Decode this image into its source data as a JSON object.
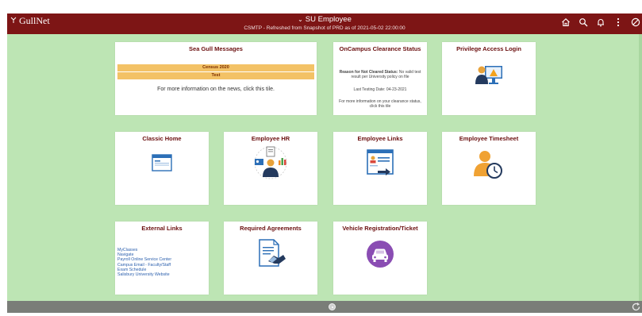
{
  "header": {
    "logo": "GullNet",
    "title": "SU Employee",
    "subtitle": "CSMTP - Refreshed from Snapshot of PRD as of 2021-05-02 22:00:00",
    "icons": [
      "home-icon",
      "search-icon",
      "notification-bell-icon",
      "actions-menu-icon",
      "navbar-icon"
    ]
  },
  "tiles": {
    "sea_gull_messages": {
      "title": "Sea Gull Messages",
      "messages": [
        "Census 2020",
        "Test"
      ],
      "info": "For more information on the news, click this tile."
    },
    "oncampus": {
      "title": "OnCampus Clearance Status",
      "reason_label": "Reason for Not Cleared Status:",
      "reason_value": "No valid test result per University policy on file",
      "last_testing": "Last Testing Date: 04-23-2021",
      "more_info": "For more information on your clearance status, click this tile"
    },
    "privilege_access": {
      "title": "Privilege Access Login"
    },
    "classic_home": {
      "title": "Classic Home"
    },
    "employee_hr": {
      "title": "Employee HR"
    },
    "employee_links": {
      "title": "Employee Links"
    },
    "employee_timesheet": {
      "title": "Employee Timesheet"
    },
    "external_links": {
      "title": "External Links",
      "links": [
        "MyClasses",
        "Navigate",
        "Payroll Online Service Center",
        "Campus Email - Faculty/Staff",
        "Exam Schedule",
        "Salisbury University Website"
      ]
    },
    "required_agreements": {
      "title": "Required Agreements"
    },
    "vehicle_registration": {
      "title": "Vehicle Registration/Ticket"
    }
  },
  "colors": {
    "header_bg": "#7d1515",
    "page_bg": "#bde5b4",
    "tile_title": "#6b0f0f",
    "message_bar": "#f3c266",
    "vehicle_icon": "#8a4db3",
    "link": "#2b5fad"
  }
}
